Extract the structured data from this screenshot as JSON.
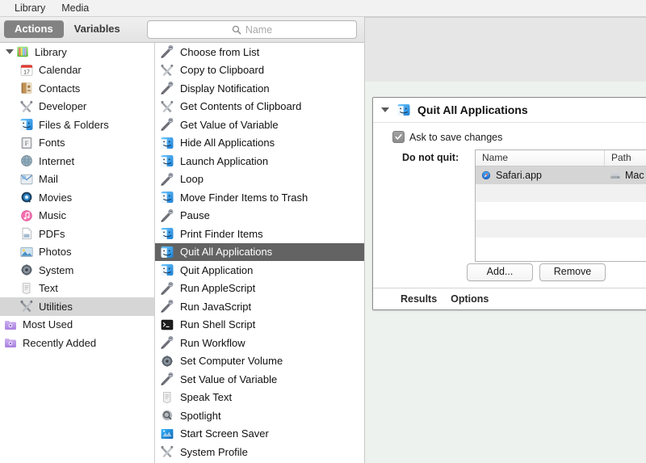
{
  "menubar": {
    "items": [
      {
        "label": "Library",
        "name": "menu-library"
      },
      {
        "label": "Media",
        "name": "menu-media"
      }
    ]
  },
  "tabbar": {
    "tabs": [
      {
        "label": "Actions",
        "selected": true
      },
      {
        "label": "Variables",
        "selected": false
      }
    ],
    "search": {
      "placeholder": "Name",
      "value": "",
      "icon": "search-icon"
    }
  },
  "sidebar": {
    "items": [
      {
        "label": "Library",
        "icon": "library-icon",
        "level": 0,
        "expanded": true,
        "selected": false
      },
      {
        "label": "Calendar",
        "icon": "calendar-icon",
        "level": 1,
        "selected": false
      },
      {
        "label": "Contacts",
        "icon": "contacts-icon",
        "level": 1,
        "selected": false
      },
      {
        "label": "Developer",
        "icon": "developer-icon",
        "level": 1,
        "selected": false
      },
      {
        "label": "Files & Folders",
        "icon": "finder-icon",
        "level": 1,
        "selected": false
      },
      {
        "label": "Fonts",
        "icon": "fonts-icon",
        "level": 1,
        "selected": false
      },
      {
        "label": "Internet",
        "icon": "internet-icon",
        "level": 1,
        "selected": false
      },
      {
        "label": "Mail",
        "icon": "mail-icon",
        "level": 1,
        "selected": false
      },
      {
        "label": "Movies",
        "icon": "movies-icon",
        "level": 1,
        "selected": false
      },
      {
        "label": "Music",
        "icon": "music-icon",
        "level": 1,
        "selected": false
      },
      {
        "label": "PDFs",
        "icon": "pdf-icon",
        "level": 1,
        "selected": false
      },
      {
        "label": "Photos",
        "icon": "photos-icon",
        "level": 1,
        "selected": false
      },
      {
        "label": "System",
        "icon": "system-icon",
        "level": 1,
        "selected": false
      },
      {
        "label": "Text",
        "icon": "text-icon",
        "level": 1,
        "selected": false
      },
      {
        "label": "Utilities",
        "icon": "utilities-icon",
        "level": 1,
        "selected": true
      },
      {
        "label": "Most Used",
        "icon": "smart-folder-icon",
        "level": 0,
        "selected": false
      },
      {
        "label": "Recently Added",
        "icon": "smart-folder-icon",
        "level": 0,
        "selected": false
      }
    ]
  },
  "actions": {
    "items": [
      {
        "label": "Choose from List",
        "icon": "automator-robot-icon",
        "selected": false
      },
      {
        "label": "Copy to Clipboard",
        "icon": "developer-icon",
        "selected": false
      },
      {
        "label": "Display Notification",
        "icon": "automator-robot-icon",
        "selected": false
      },
      {
        "label": "Get Contents of Clipboard",
        "icon": "developer-icon",
        "selected": false
      },
      {
        "label": "Get Value of Variable",
        "icon": "automator-robot-icon",
        "selected": false
      },
      {
        "label": "Hide All Applications",
        "icon": "finder-icon",
        "selected": false
      },
      {
        "label": "Launch Application",
        "icon": "finder-icon",
        "selected": false
      },
      {
        "label": "Loop",
        "icon": "automator-robot-icon",
        "selected": false
      },
      {
        "label": "Move Finder Items to Trash",
        "icon": "finder-icon",
        "selected": false
      },
      {
        "label": "Pause",
        "icon": "automator-robot-icon",
        "selected": false
      },
      {
        "label": "Print Finder Items",
        "icon": "finder-icon",
        "selected": false
      },
      {
        "label": "Quit All Applications",
        "icon": "finder-icon",
        "selected": true
      },
      {
        "label": "Quit Application",
        "icon": "finder-icon",
        "selected": false
      },
      {
        "label": "Run AppleScript",
        "icon": "automator-robot-icon",
        "selected": false
      },
      {
        "label": "Run JavaScript",
        "icon": "automator-robot-icon",
        "selected": false
      },
      {
        "label": "Run Shell Script",
        "icon": "terminal-icon",
        "selected": false
      },
      {
        "label": "Run Workflow",
        "icon": "automator-robot-icon",
        "selected": false
      },
      {
        "label": "Set Computer Volume",
        "icon": "system-icon",
        "selected": false
      },
      {
        "label": "Set Value of Variable",
        "icon": "automator-robot-icon",
        "selected": false
      },
      {
        "label": "Speak Text",
        "icon": "text-icon",
        "selected": false
      },
      {
        "label": "Spotlight",
        "icon": "spotlight-icon",
        "selected": false
      },
      {
        "label": "Start Screen Saver",
        "icon": "screensaver-icon",
        "selected": false
      },
      {
        "label": "System Profile",
        "icon": "developer-icon",
        "selected": false
      }
    ]
  },
  "action_card": {
    "title": "Quit All Applications",
    "icon": "finder-icon",
    "disclosure": "chevron-down-icon",
    "ask_to_save": {
      "label": "Ask to save changes",
      "checked": true
    },
    "do_not_quit": {
      "label": "Do not quit:",
      "columns": [
        "Name",
        "Path"
      ],
      "rows": [
        {
          "name": "Safari.app",
          "path": "Mac",
          "icon": "safari-icon",
          "path_icon": "hard-drive-icon",
          "selected": true
        },
        {
          "name": "",
          "path": "",
          "selected": false
        },
        {
          "name": "",
          "path": "",
          "selected": false
        },
        {
          "name": "",
          "path": "",
          "selected": false
        },
        {
          "name": "",
          "path": "",
          "selected": false
        }
      ]
    },
    "buttons": [
      {
        "label": "Add...",
        "name": "add-button"
      },
      {
        "label": "Remove",
        "name": "remove-button"
      }
    ],
    "footer_tabs": [
      {
        "label": "Results"
      },
      {
        "label": "Options"
      }
    ]
  },
  "colors": {
    "selection_active": "#636363",
    "selection_inactive": "#d6d6d6",
    "tab_selected": "#828282",
    "canvas": "#edf2ef",
    "chrome": "#e6e6e6"
  }
}
